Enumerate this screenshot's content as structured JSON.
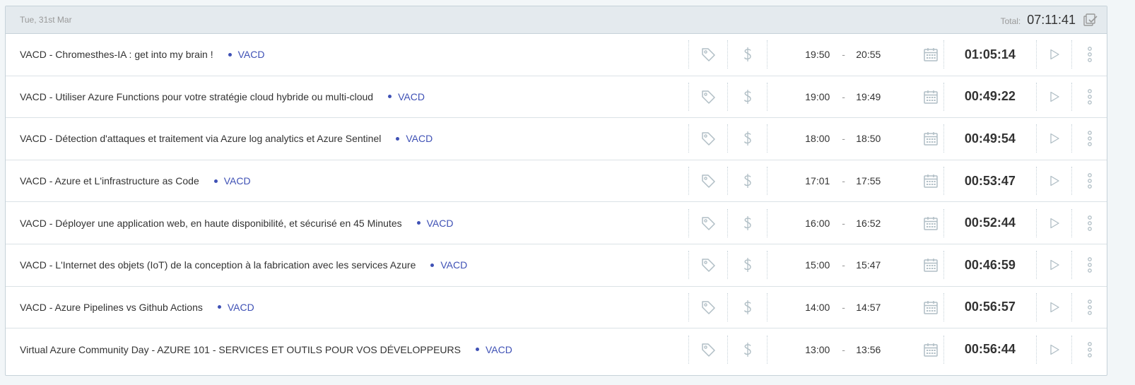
{
  "day": {
    "date": "Tue, 31st Mar",
    "total_label": "Total:",
    "total_value": "07:11:41"
  },
  "colors": {
    "project": "#3f51b5",
    "header_bg": "#e4eaee",
    "icon": "#b0bec5"
  },
  "icons": {
    "bulk_edit": "bulk-edit-icon",
    "tag": "tag-icon",
    "billable": "dollar-icon",
    "calendar": "calendar-icon",
    "play": "play-icon",
    "more": "kebab-menu-icon"
  },
  "entries": [
    {
      "description": "VACD - Chromesthes-IA : get into my brain !",
      "project": "VACD",
      "start": "19:50",
      "end": "20:55",
      "duration": "01:05:14"
    },
    {
      "description": "VACD - Utiliser Azure Functions pour votre stratégie cloud hybride ou multi-cloud",
      "project": "VACD",
      "start": "19:00",
      "end": "19:49",
      "duration": "00:49:22"
    },
    {
      "description": "VACD - Détection d'attaques et traitement via Azure log analytics et Azure Sentinel",
      "project": "VACD",
      "start": "18:00",
      "end": "18:50",
      "duration": "00:49:54"
    },
    {
      "description": "VACD - Azure et L'infrastructure as Code",
      "project": "VACD",
      "start": "17:01",
      "end": "17:55",
      "duration": "00:53:47"
    },
    {
      "description": "VACD - Déployer une application web, en haute disponibilité, et sécurisé en 45 Minutes",
      "project": "VACD",
      "start": "16:00",
      "end": "16:52",
      "duration": "00:52:44"
    },
    {
      "description": "VACD - L'Internet des objets (IoT) de la conception à la fabrication avec les services Azure",
      "project": "VACD",
      "start": "15:00",
      "end": "15:47",
      "duration": "00:46:59"
    },
    {
      "description": "VACD - Azure Pipelines vs Github Actions",
      "project": "VACD",
      "start": "14:00",
      "end": "14:57",
      "duration": "00:56:57"
    },
    {
      "description": "Virtual Azure Community Day - AZURE 101 - SERVICES ET OUTILS POUR VOS DÉVELOPPEURS",
      "project": "VACD",
      "start": "13:00",
      "end": "13:56",
      "duration": "00:56:44"
    }
  ]
}
